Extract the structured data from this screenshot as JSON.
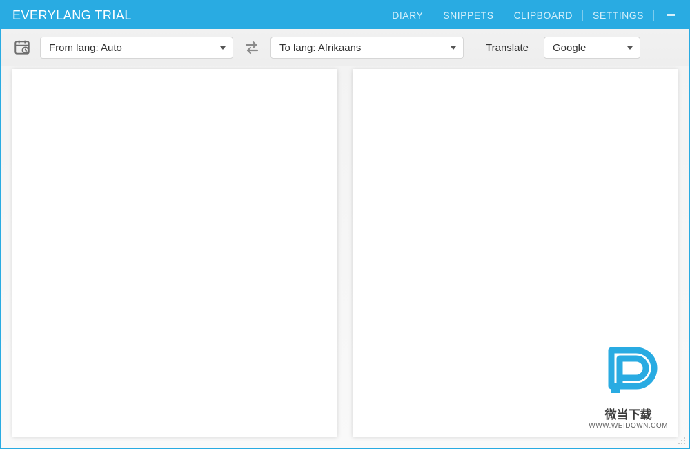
{
  "header": {
    "title": "EVERYLANG TRIAL",
    "nav": [
      "DIARY",
      "SNIPPETS",
      "CLIPBOARD",
      "SETTINGS"
    ]
  },
  "toolbar": {
    "from_lang": "From lang: Auto",
    "to_lang": "To lang: Afrikaans",
    "translate_label": "Translate",
    "engine": "Google"
  },
  "watermark": {
    "text": "微当下载",
    "url": "WWW.WEIDOWN.COM"
  }
}
